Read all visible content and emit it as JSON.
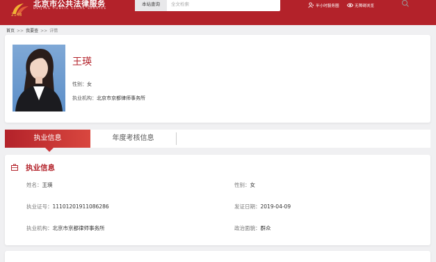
{
  "header": {
    "site_title": "北京市公共法律服务",
    "site_subtitle": "BEIJING   PUBLIC   LEGAL   SERVICE",
    "search_scope": "本站查询",
    "search_placeholder": "全文检索",
    "link_hours": "半小时服务圈",
    "link_accessible": "无障碍浏览"
  },
  "breadcrumb": {
    "home": "首页",
    "sep": ">>",
    "section": "我要查",
    "current": "详情"
  },
  "profile": {
    "name": "王瑛",
    "gender_label": "性别：",
    "gender_value": "女",
    "firm_label": "执业机构：",
    "firm_value": "北京市京都律师事务所"
  },
  "tabs": {
    "practice": "执业信息",
    "annual": "年度考核信息"
  },
  "practice_info": {
    "title": "执业信息",
    "name_label": "姓名：",
    "name_value": "王瑛",
    "gender_label": "性别：",
    "gender_value": "女",
    "cert_label": "执业证号：",
    "cert_value": "11101201911086286",
    "issue_label": "发证日期：",
    "issue_value": "2019-04-09",
    "firm_label": "执业机构：",
    "firm_value": "北京市京都律师事务所",
    "political_label": "政治面貌：",
    "political_value": "群众"
  },
  "colors": {
    "brand": "#b3222a",
    "background": "#f0f0f2"
  }
}
